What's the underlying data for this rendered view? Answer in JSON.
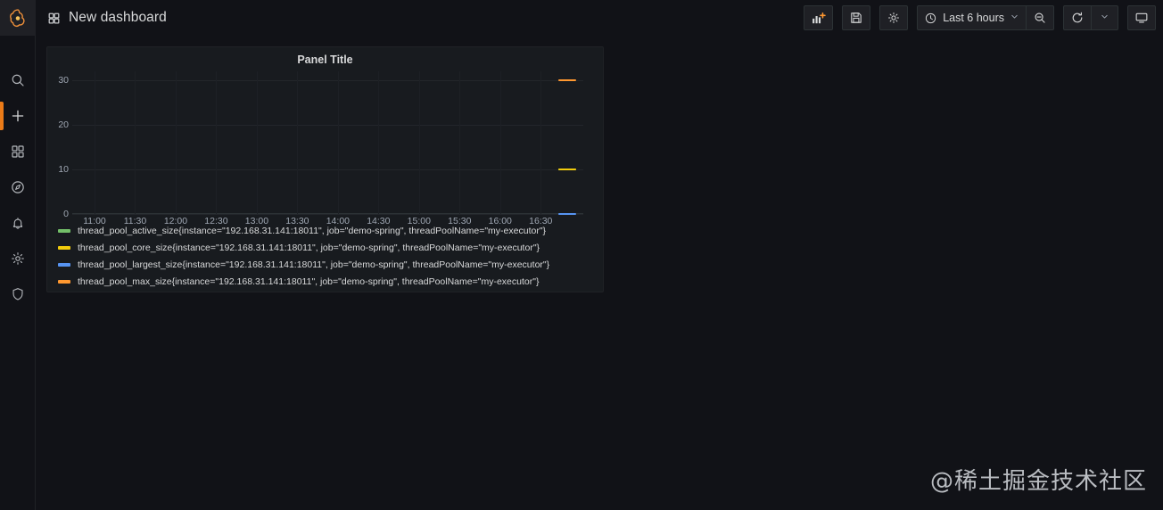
{
  "sidebar": {
    "brand_icon": "grafana-logo-icon",
    "items": [
      {
        "name": "search",
        "icon": "search-icon",
        "active": false
      },
      {
        "name": "create",
        "icon": "plus-icon",
        "active": true
      },
      {
        "name": "dashboards",
        "icon": "grid-icon",
        "active": false
      },
      {
        "name": "explore",
        "icon": "compass-icon",
        "active": false
      },
      {
        "name": "alerting",
        "icon": "bell-icon",
        "active": false
      },
      {
        "name": "configuration",
        "icon": "gear-icon",
        "active": false
      },
      {
        "name": "server-admin",
        "icon": "shield-icon",
        "active": false
      }
    ]
  },
  "header": {
    "title_icon": "dashboard-grid-icon",
    "title": "New dashboard",
    "toolbar": {
      "add_panel_label": "add-panel",
      "save_label": "save-dashboard",
      "settings_label": "dashboard-settings",
      "time_range": "Last 6 hours",
      "time_icon": "clock-icon",
      "time_chevron": "⌄",
      "zoom_out_label": "zoom-out-time-range",
      "refresh_label": "refresh-dashboard",
      "refresh_chevron": "⌄",
      "kiosk_label": "cycle-view-mode"
    }
  },
  "panel": {
    "title": "Panel Title"
  },
  "chart_data": {
    "type": "line",
    "title": "Panel Title",
    "xlabel": "",
    "ylabel": "",
    "ylim": [
      0,
      32
    ],
    "yticks": [
      0,
      10,
      20,
      30
    ],
    "ytick_labels": [
      "0",
      "10",
      "20",
      "30"
    ],
    "xtick_labels": [
      "11:00",
      "11:30",
      "12:00",
      "12:30",
      "13:00",
      "13:30",
      "14:00",
      "14:30",
      "15:00",
      "15:30",
      "16:00",
      "16:30"
    ],
    "xlim_labels": [
      "10:45",
      "16:45"
    ],
    "grid": true,
    "legend_position": "bottom-left",
    "series": [
      {
        "name": "thread_pool_active_size{instance=\"192.168.31.141:18011\", job=\"demo-spring\", threadPoolName=\"my-executor\"}",
        "metric": "thread_pool_active_size",
        "color": "#73BF69",
        "value": 10,
        "x_start_label": "16:32",
        "x_end_label": "16:42"
      },
      {
        "name": "thread_pool_core_size{instance=\"192.168.31.141:18011\", job=\"demo-spring\", threadPoolName=\"my-executor\"}",
        "metric": "thread_pool_core_size",
        "color": "#F2CC0C",
        "value": 10,
        "x_start_label": "16:32",
        "x_end_label": "16:42"
      },
      {
        "name": "thread_pool_largest_size{instance=\"192.168.31.141:18011\", job=\"demo-spring\", threadPoolName=\"my-executor\"}",
        "metric": "thread_pool_largest_size",
        "color": "#5794F2",
        "value": 0,
        "x_start_label": "16:32",
        "x_end_label": "16:42"
      },
      {
        "name": "thread_pool_max_size{instance=\"192.168.31.141:18011\", job=\"demo-spring\", threadPoolName=\"my-executor\"}",
        "metric": "thread_pool_max_size",
        "color": "#FF9830",
        "value": 30,
        "x_start_label": "16:32",
        "x_end_label": "16:42"
      }
    ]
  },
  "watermark": {
    "text": "@稀土掘金技术社区"
  }
}
